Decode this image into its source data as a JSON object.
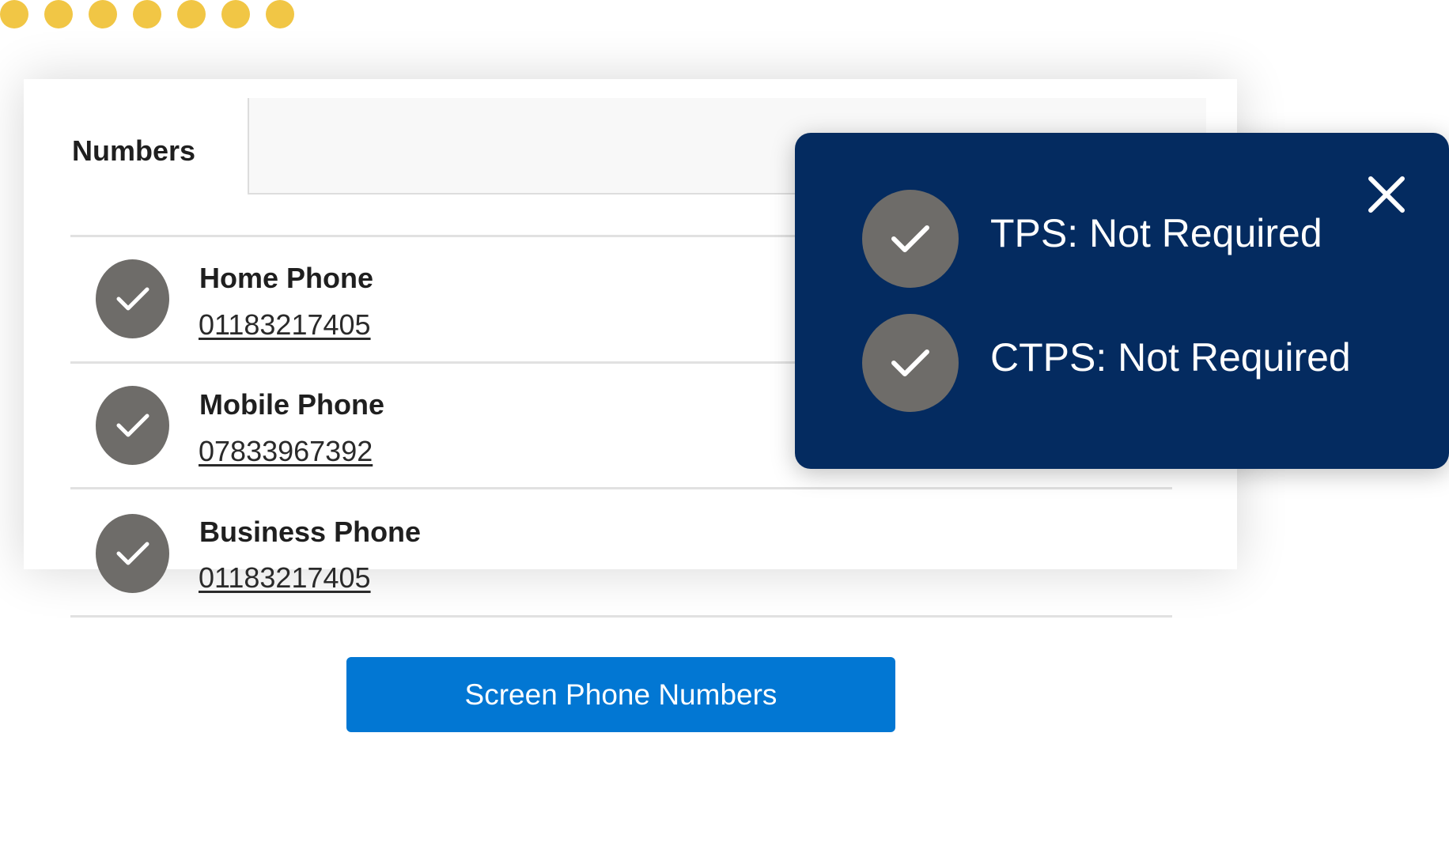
{
  "colors": {
    "accent_dot": "#f1c645",
    "popover_bg": "#042b60",
    "button_bg": "#0277d3",
    "check_bg": "#6e6c69"
  },
  "numbers_section": {
    "label": "Numbers"
  },
  "phones": [
    {
      "label": "Home Phone",
      "number": "01183217405",
      "status_icon": "check-icon"
    },
    {
      "label": "Mobile Phone",
      "number": "07833967392",
      "status_icon": "check-icon"
    },
    {
      "label": "Business Phone",
      "number": "01183217405",
      "status_icon": "check-icon"
    }
  ],
  "screen_button": {
    "label": "Screen Phone Numbers"
  },
  "popover": {
    "close_icon": "close-icon",
    "items": [
      {
        "text": "TPS: Not Required",
        "icon": "check-icon"
      },
      {
        "text": "CTPS: Not Required",
        "icon": "check-icon"
      }
    ]
  }
}
